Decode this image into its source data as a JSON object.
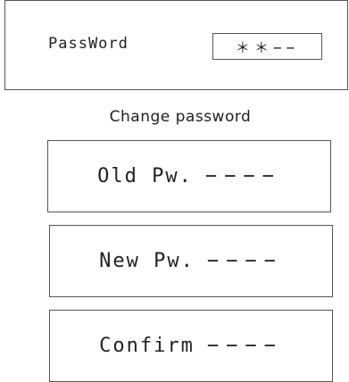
{
  "login": {
    "label": "PassWord",
    "value": "＊＊−−"
  },
  "change": {
    "title": "Change password",
    "old": {
      "label": "Old Pw.",
      "value": "−−−−"
    },
    "new": {
      "label": "New Pw.",
      "value": "−−−−"
    },
    "confirm": {
      "label": "Confirm",
      "value": "−−−−"
    }
  }
}
